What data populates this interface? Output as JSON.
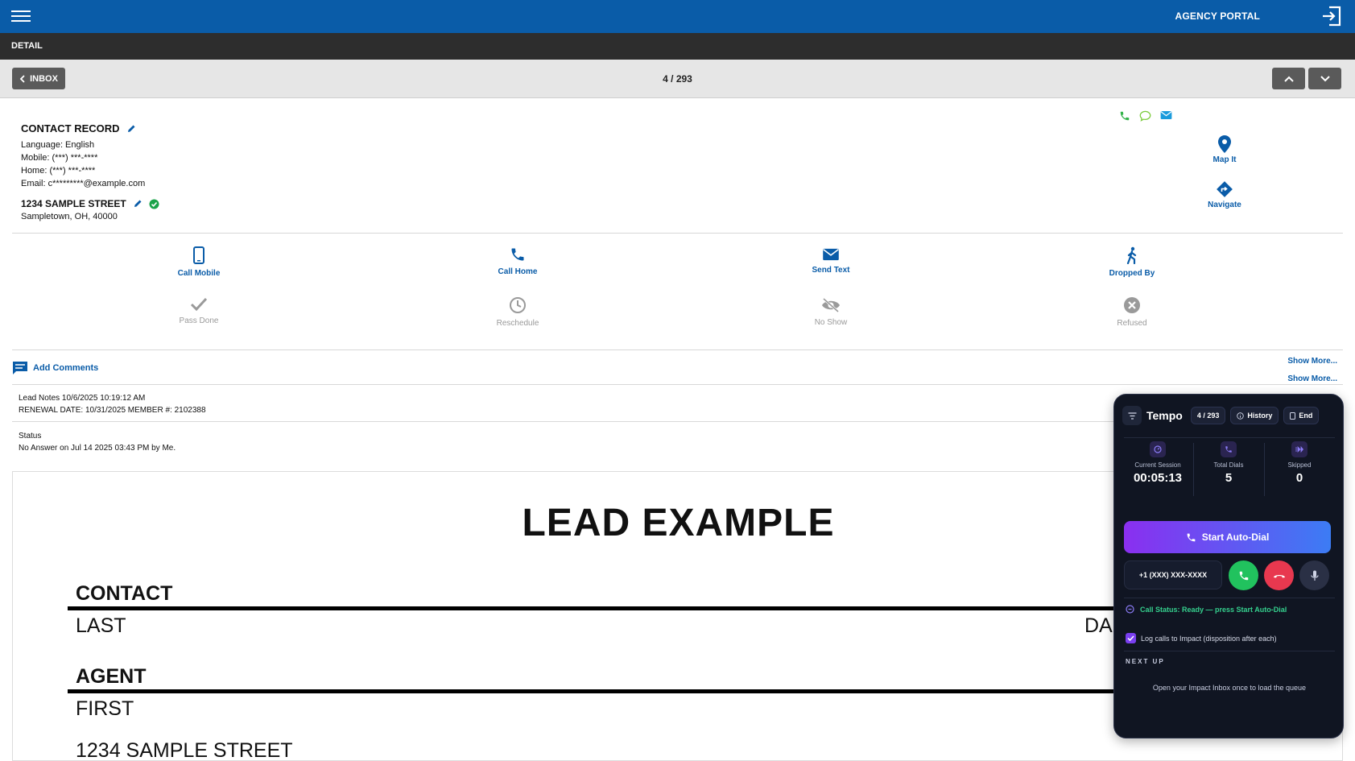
{
  "topbar": {
    "portal_label": "AGENCY PORTAL",
    "icons": [
      "menu-icon",
      "sign-out-icon"
    ]
  },
  "subbar": {
    "title": "DETAIL"
  },
  "navbar": {
    "inbox_label": "INBOX",
    "counter": "4 / 293"
  },
  "contact": {
    "title": "CONTACT RECORD",
    "language": "Language:  English",
    "mobile": "Mobile:   (***) ***-****",
    "home": "Home:    (***) ***-****",
    "email": "Email:   c*********@example.com",
    "address_line1": "1234 SAMPLE STREET",
    "address_line2": "Sampletown, OH, 40000"
  },
  "map_actions": {
    "map_it": "Map It",
    "navigate": "Navigate"
  },
  "actions": {
    "call_mobile": "Call Mobile",
    "call_home": "Call Home",
    "send_text": "Send Text",
    "dropped_by": "Dropped By",
    "pass_done": "Pass Done",
    "reschedule": "Reschedule",
    "no_show": "No Show",
    "refused": "Refused"
  },
  "comments": {
    "add_label": "Add Comments",
    "show_more_1": "Show More...",
    "show_more_2": "Show More...",
    "note1_line1": "Lead Notes 10/6/2025 10:19:12 AM",
    "note1_line2": "RENEWAL DATE: 10/31/2025 MEMBER #: 2102388",
    "note2_line1": "Status",
    "note2_line2": "No Answer on Jul 14 2025 03:43 PM by Me."
  },
  "document": {
    "title": "LEAD EXAMPLE",
    "section_contact": "CONTACT",
    "field_last": "LAST",
    "field_da": "DA",
    "section_agent": "AGENT",
    "field_first": "FIRST",
    "field_address": "1234 SAMPLE STREET"
  },
  "widget": {
    "brand": "Tempo",
    "counter": "4 / 293",
    "history_label": "History",
    "end_label": "End",
    "stats": {
      "session_label": "Current Session",
      "session_value": "00:05:13",
      "dials_label": "Total Dials",
      "dials_value": "5",
      "skipped_label": "Skipped",
      "skipped_value": "0"
    },
    "autodial_label": "Start Auto-Dial",
    "phone_value": "+1 (XXX) XXX-XXXX",
    "call_status": "Call Status: Ready — press Start Auto-Dial",
    "log_label": "Log calls to Impact (disposition after each)",
    "log_checked": true,
    "next_up_label": "NEXT UP",
    "queue_message": "Open your Impact Inbox once to load the queue",
    "colors": {
      "accent_purple": "#8a2ff0",
      "accent_blue": "#3c7cf4",
      "answer_green": "#21c25e",
      "hangup_red": "#e8384f",
      "status_green": "#35d08e"
    }
  }
}
